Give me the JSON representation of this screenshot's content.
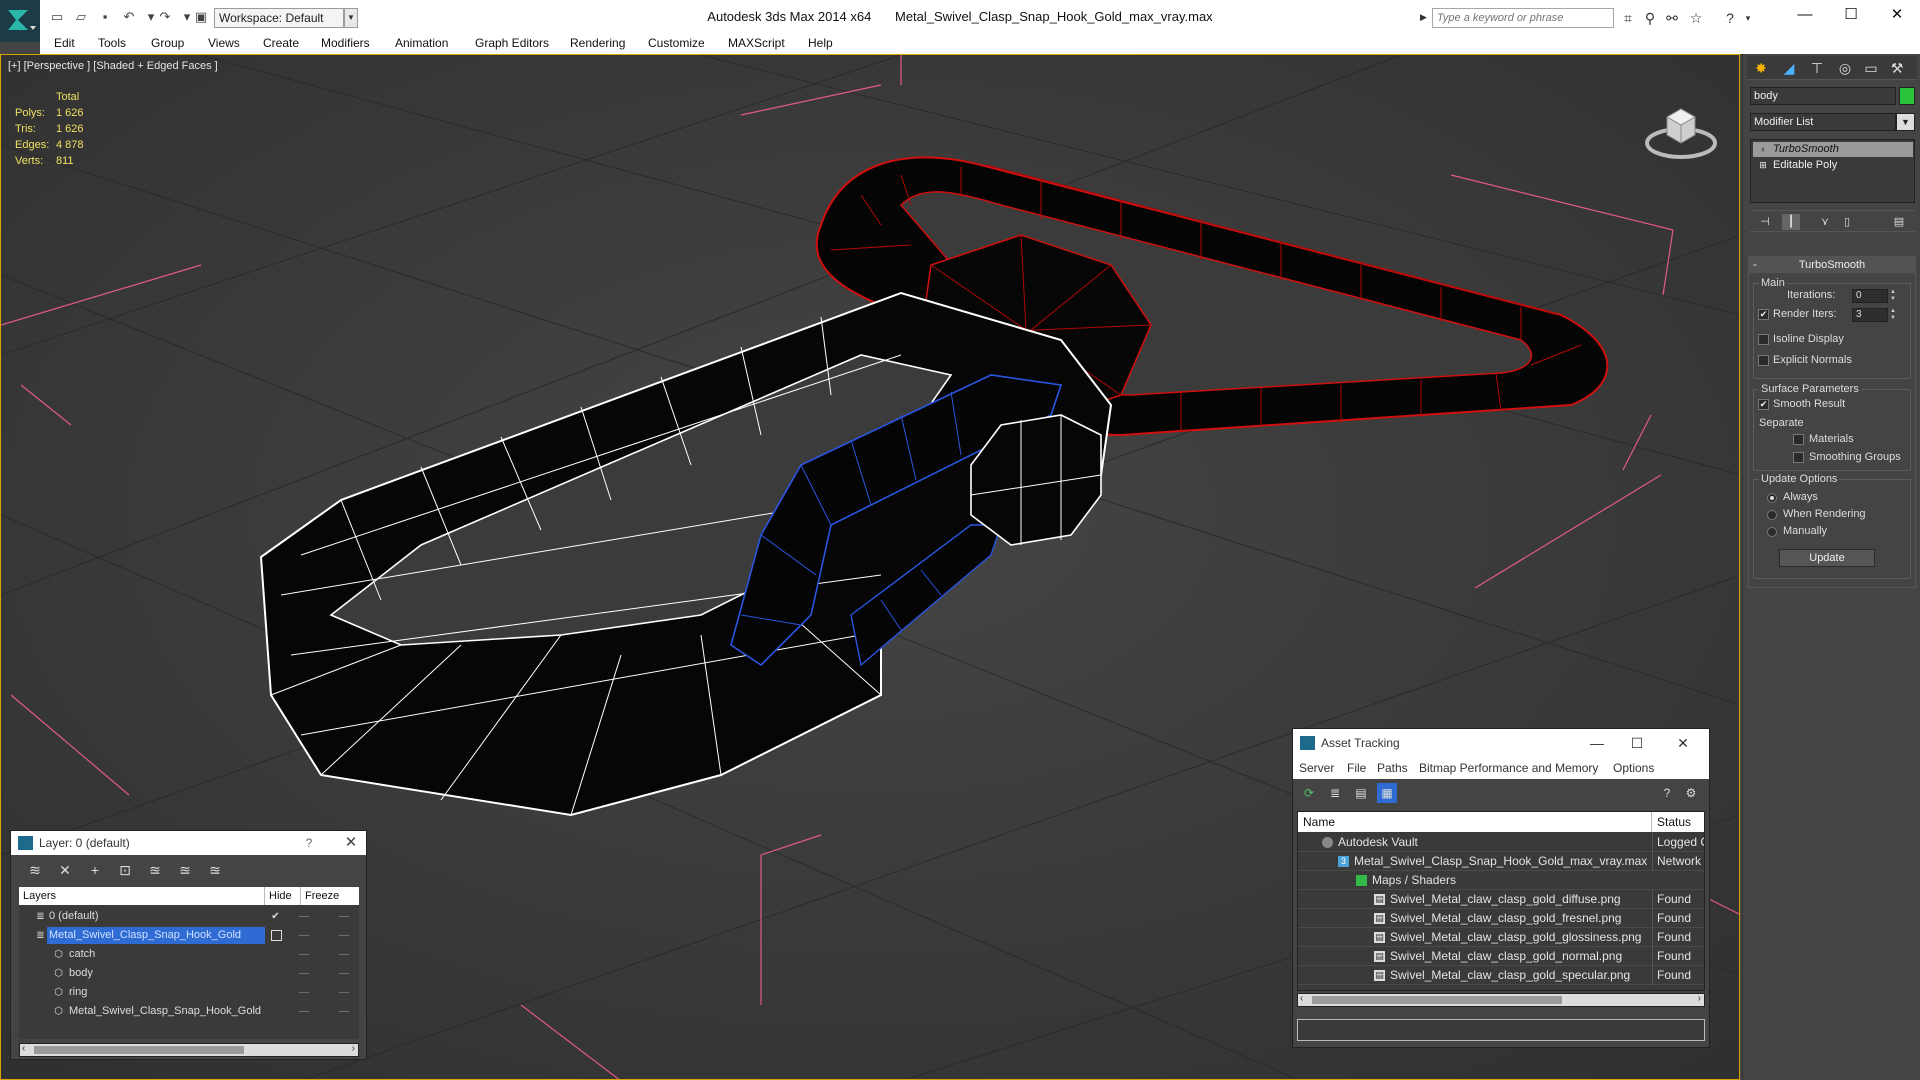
{
  "titlebar": {
    "app_name": "Autodesk 3ds Max  2014 x64",
    "file_name": "Metal_Swivel_Clasp_Snap_Hook_Gold_max_vray.max",
    "workspace_label": "Workspace: Default",
    "search_placeholder": "Type a keyword or phrase"
  },
  "menubar": {
    "items": [
      "Edit",
      "Tools",
      "Group",
      "Views",
      "Create",
      "Modifiers",
      "Animation",
      "Graph Editors",
      "Rendering",
      "Customize",
      "MAXScript",
      "Help"
    ]
  },
  "viewport": {
    "label": "[+] [Perspective ] [Shaded + Edged Faces ]",
    "stats": {
      "header": "Total",
      "rows": [
        {
          "key": "Polys:",
          "value": "1 626"
        },
        {
          "key": "Tris:",
          "value": "1 626"
        },
        {
          "key": "Edges:",
          "value": "4 878"
        },
        {
          "key": "Verts:",
          "value": "811"
        }
      ]
    }
  },
  "command_panel": {
    "object_name": "body",
    "object_color": "#29c43b",
    "modifier_list_label": "Modifier List",
    "stack": [
      "TurboSmooth",
      "Editable Poly"
    ],
    "rollout_title": "TurboSmooth",
    "main_group": "Main",
    "iterations_label": "Iterations:",
    "iterations_value": "0",
    "render_iters_label": "Render Iters:",
    "render_iters_value": "3",
    "isoline_label": "Isoline Display",
    "explicit_normals_label": "Explicit Normals",
    "surface_group": "Surface Parameters",
    "smooth_result_label": "Smooth Result",
    "separate_label": "Separate",
    "materials_label": "Materials",
    "smoothing_groups_label": "Smoothing Groups",
    "update_group": "Update Options",
    "always_label": "Always",
    "when_rendering_label": "When Rendering",
    "manually_label": "Manually",
    "update_button": "Update"
  },
  "layer_panel": {
    "title": "Layer: 0 (default)",
    "help": "?",
    "col_layers": "Layers",
    "col_hide": "Hide",
    "col_freeze": "Freeze",
    "rows": [
      {
        "name": "0 (default)",
        "level": 0
      },
      {
        "name": "Metal_Swivel_Clasp_Snap_Hook_Gold",
        "level": 0
      },
      {
        "name": "catch",
        "level": 1
      },
      {
        "name": "body",
        "level": 1
      },
      {
        "name": "ring",
        "level": 1
      },
      {
        "name": "Metal_Swivel_Clasp_Snap_Hook_Gold",
        "level": 1
      }
    ]
  },
  "asset_panel": {
    "title": "Asset Tracking",
    "menu": [
      "Server",
      "File",
      "Paths",
      "Bitmap Performance and Memory",
      "Options"
    ],
    "col_name": "Name",
    "col_status": "Status",
    "rows": [
      {
        "name": "Autodesk Vault",
        "status": "Logged O"
      },
      {
        "name": "Metal_Swivel_Clasp_Snap_Hook_Gold_max_vray.max",
        "status": "Network P"
      },
      {
        "name": "Maps / Shaders",
        "status": ""
      },
      {
        "name": "Swivel_Metal_claw_clasp_gold_diffuse.png",
        "status": "Found"
      },
      {
        "name": "Swivel_Metal_claw_clasp_gold_fresnel.png",
        "status": "Found"
      },
      {
        "name": "Swivel_Metal_claw_clasp_gold_glossiness.png",
        "status": "Found"
      },
      {
        "name": "Swivel_Metal_claw_clasp_gold_normal.png",
        "status": "Found"
      },
      {
        "name": "Swivel_Metal_claw_clasp_gold_specular.png",
        "status": "Found"
      }
    ]
  }
}
